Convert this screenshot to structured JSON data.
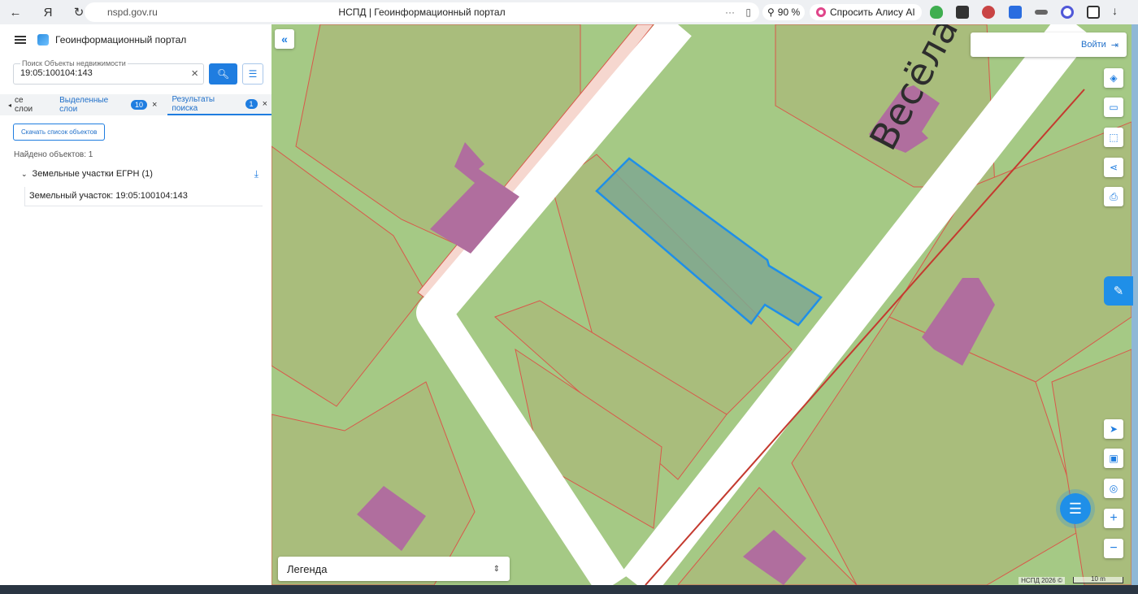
{
  "browser": {
    "url": "nspd.gov.ru",
    "tab_title": "НСПД | Геоинформационный портал",
    "zoom": "90 %",
    "alice_label": "Спросить Алису AI"
  },
  "app": {
    "title": "Геоинформационный портал"
  },
  "search": {
    "label": "Поиск Объекты недвижимости",
    "value": "19:05:100104:143"
  },
  "tabs": [
    {
      "label": "се слои"
    },
    {
      "label": "Выделенные слои",
      "badge": "10"
    },
    {
      "label": "Результаты поиска",
      "badge": "1"
    }
  ],
  "results": {
    "download_label": "Скачать список объектов",
    "found_label": "Найдено объектов: 1",
    "group_label": "Земельные участки ЕГРН (1)",
    "item_label": "Земельный участок: 19:05:100104:143"
  },
  "map": {
    "login_label": "Войти",
    "street_label": "Весёлая ул",
    "legend_label": "Легенда",
    "attribution": "НСПД 2026 ©",
    "scale_label": "10 m",
    "colors": {
      "parcel_fill": "#a9bd7c",
      "ground": "#a5c985",
      "building": "#b06e9e",
      "boundary": "#d9584a",
      "selected": "#1f8fe8",
      "road": "#ffffff"
    }
  }
}
